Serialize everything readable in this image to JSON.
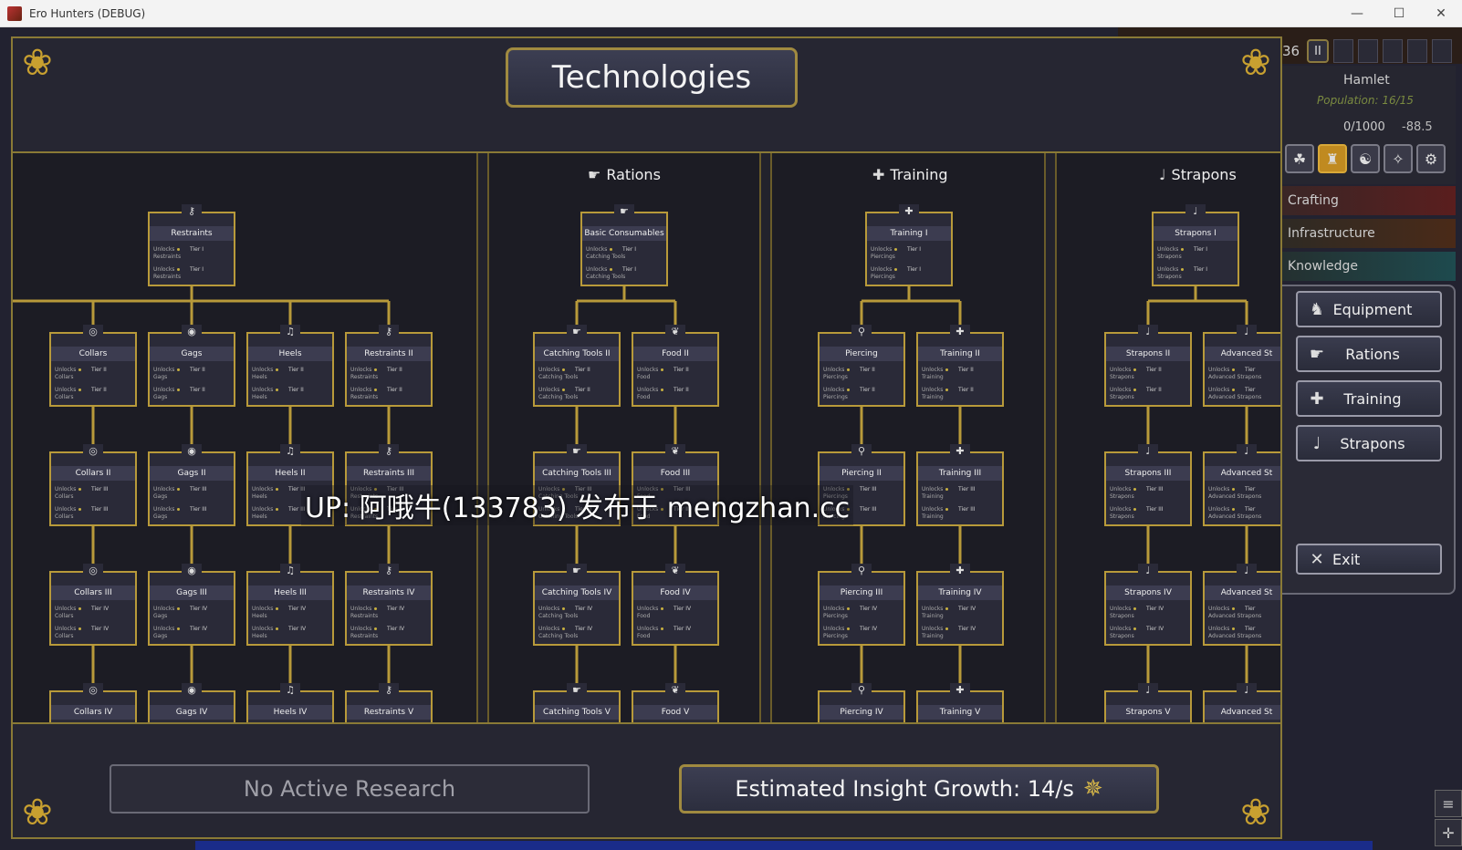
{
  "window": {
    "title": "Ero Hunters (DEBUG)",
    "minimize": "—",
    "maximize": "☐",
    "close": "✕"
  },
  "hud": {
    "day": "36",
    "pause": "II",
    "settlement": "Hamlet",
    "population": "Population: 16/15",
    "resource": "0/1000",
    "rate": "-88.5",
    "categories": [
      "Crafting",
      "Infrastructure",
      "Knowledge"
    ],
    "icon_glyphs": [
      "☘",
      "♜",
      "☯",
      "✧",
      "⚙"
    ]
  },
  "side_buttons": [
    {
      "label": "Equipment",
      "icon": "♞"
    },
    {
      "label": "Rations",
      "icon": "☛"
    },
    {
      "label": "Training",
      "icon": "✚"
    },
    {
      "label": "Strapons",
      "icon": "♩"
    }
  ],
  "exit_button": {
    "label": "Exit",
    "icon": "✕"
  },
  "modal": {
    "title": "Technologies",
    "columns": [
      {
        "title": "Rations",
        "icon": "☛"
      },
      {
        "title": "Training",
        "icon": "✚"
      },
      {
        "title": "Strapons",
        "icon": "♩"
      }
    ]
  },
  "node_text": {
    "unlocks": "Unlocks",
    "tier_prefix": "Tier"
  },
  "nodes": [
    {
      "name": "Restraints",
      "col": 0,
      "row": 0,
      "icon": "⚷",
      "sub": "Restraints",
      "tier": "Tier I"
    },
    {
      "name": "Collars",
      "col": 1,
      "row": 1,
      "icon": "◎",
      "sub": "Collars",
      "tier": "Tier II"
    },
    {
      "name": "Gags",
      "col": 2,
      "row": 1,
      "icon": "◉",
      "sub": "Gags",
      "tier": "Tier II"
    },
    {
      "name": "Heels",
      "col": 3,
      "row": 1,
      "icon": "♫",
      "sub": "Heels",
      "tier": "Tier II"
    },
    {
      "name": "Restraints II",
      "col": 4,
      "row": 1,
      "icon": "⚷",
      "sub": "Restraints",
      "tier": "Tier II"
    },
    {
      "name": "Collars II",
      "col": 1,
      "row": 2,
      "icon": "◎",
      "sub": "Collars",
      "tier": "Tier III"
    },
    {
      "name": "Gags II",
      "col": 2,
      "row": 2,
      "icon": "◉",
      "sub": "Gags",
      "tier": "Tier III"
    },
    {
      "name": "Heels II",
      "col": 3,
      "row": 2,
      "icon": "♫",
      "sub": "Heels",
      "tier": "Tier III"
    },
    {
      "name": "Restraints III",
      "col": 4,
      "row": 2,
      "icon": "⚷",
      "sub": "Restraints",
      "tier": "Tier III"
    },
    {
      "name": "Collars III",
      "col": 1,
      "row": 3,
      "icon": "◎",
      "sub": "Collars",
      "tier": "Tier IV"
    },
    {
      "name": "Gags III",
      "col": 2,
      "row": 3,
      "icon": "◉",
      "sub": "Gags",
      "tier": "Tier IV"
    },
    {
      "name": "Heels III",
      "col": 3,
      "row": 3,
      "icon": "♫",
      "sub": "Heels",
      "tier": "Tier IV"
    },
    {
      "name": "Restraints IV",
      "col": 4,
      "row": 3,
      "icon": "⚷",
      "sub": "Restraints",
      "tier": "Tier IV"
    },
    {
      "name": "Collars IV",
      "col": 1,
      "row": 4,
      "icon": "◎",
      "sub": "",
      "tier": ""
    },
    {
      "name": "Gags IV",
      "col": 2,
      "row": 4,
      "icon": "◉",
      "sub": "",
      "tier": ""
    },
    {
      "name": "Heels IV",
      "col": 3,
      "row": 4,
      "icon": "♫",
      "sub": "",
      "tier": ""
    },
    {
      "name": "Restraints V",
      "col": 4,
      "row": 4,
      "icon": "⚷",
      "sub": "",
      "tier": ""
    },
    {
      "name": "Basic Consumables",
      "col": 6,
      "row": 0,
      "icon": "☛",
      "sub": "Catching Tools",
      "tier": "Tier I"
    },
    {
      "name": "Catching Tools II",
      "col": 5,
      "row": 1,
      "icon": "☛",
      "sub": "Catching Tools",
      "tier": "Tier II"
    },
    {
      "name": "Food II",
      "col": 6,
      "row": 1,
      "icon": "❦",
      "sub": "Food",
      "tier": "Tier II"
    },
    {
      "name": "Catching Tools III",
      "col": 5,
      "row": 2,
      "icon": "☛",
      "sub": "Catching Tools",
      "tier": "Tier III"
    },
    {
      "name": "Food III",
      "col": 6,
      "row": 2,
      "icon": "❦",
      "sub": "Food",
      "tier": "Tier III"
    },
    {
      "name": "Catching Tools IV",
      "col": 5,
      "row": 3,
      "icon": "☛",
      "sub": "Catching Tools",
      "tier": "Tier IV"
    },
    {
      "name": "Food IV",
      "col": 6,
      "row": 3,
      "icon": "❦",
      "sub": "Food",
      "tier": "Tier IV"
    },
    {
      "name": "Catching Tools V",
      "col": 5,
      "row": 4,
      "icon": "☛",
      "sub": "",
      "tier": ""
    },
    {
      "name": "Food V",
      "col": 6,
      "row": 4,
      "icon": "❦",
      "sub": "",
      "tier": ""
    },
    {
      "name": "Training I",
      "col": 8,
      "row": 0,
      "icon": "✚",
      "sub": "Piercings",
      "tier": "Tier I"
    },
    {
      "name": "Piercing",
      "col": 7,
      "row": 1,
      "icon": "⚲",
      "sub": "Piercings",
      "tier": "Tier II"
    },
    {
      "name": "Training II",
      "col": 8,
      "row": 1,
      "icon": "✚",
      "sub": "Training",
      "tier": "Tier II"
    },
    {
      "name": "Piercing II",
      "col": 7,
      "row": 2,
      "icon": "⚲",
      "sub": "Piercings",
      "tier": "Tier III"
    },
    {
      "name": "Training III",
      "col": 8,
      "row": 2,
      "icon": "✚",
      "sub": "Training",
      "tier": "Tier III"
    },
    {
      "name": "Piercing III",
      "col": 7,
      "row": 3,
      "icon": "⚲",
      "sub": "Piercings",
      "tier": "Tier IV"
    },
    {
      "name": "Training IV",
      "col": 8,
      "row": 3,
      "icon": "✚",
      "sub": "Training",
      "tier": "Tier IV"
    },
    {
      "name": "Piercing IV",
      "col": 7,
      "row": 4,
      "icon": "⚲",
      "sub": "",
      "tier": ""
    },
    {
      "name": "Training V",
      "col": 8,
      "row": 4,
      "icon": "✚",
      "sub": "",
      "tier": ""
    },
    {
      "name": "Strapons I",
      "col": 10,
      "row": 0,
      "icon": "♩",
      "sub": "Strapons",
      "tier": "Tier I"
    },
    {
      "name": "Strapons II",
      "col": 9,
      "row": 1,
      "icon": "♩",
      "sub": "Strapons",
      "tier": "Tier II"
    },
    {
      "name": "Advanced St",
      "col": 10,
      "row": 1,
      "icon": "♩",
      "sub": "Advanced Strapons",
      "tier": "Tier"
    },
    {
      "name": "Strapons III",
      "col": 9,
      "row": 2,
      "icon": "♩",
      "sub": "Strapons",
      "tier": "Tier III"
    },
    {
      "name": "Advanced St",
      "col": 10,
      "row": 2,
      "icon": "♩",
      "sub": "Advanced Strapons",
      "tier": "Tier"
    },
    {
      "name": "Strapons IV",
      "col": 9,
      "row": 3,
      "icon": "♩",
      "sub": "Strapons",
      "tier": "Tier IV"
    },
    {
      "name": "Advanced St",
      "col": 10,
      "row": 3,
      "icon": "♩",
      "sub": "Advanced Strapons",
      "tier": "Tier"
    },
    {
      "name": "Strapons V",
      "col": 9,
      "row": 4,
      "icon": "♩",
      "sub": "",
      "tier": ""
    },
    {
      "name": "Advanced St",
      "col": 10,
      "row": 4,
      "icon": "♩",
      "sub": "",
      "tier": ""
    }
  ],
  "bottom": {
    "no_research": "No Active Research",
    "insight": "Estimated Insight Growth: 14/s",
    "insight_icon": "✵"
  },
  "watermark": "UP: 阿哦牛(133783) 发布于 mengzhan.cc",
  "colors": {
    "gold_border": "#b89a3a",
    "panel": "#2a2a38",
    "tree_bg": "#1c1c24",
    "accent_gold": "#c08a20"
  }
}
